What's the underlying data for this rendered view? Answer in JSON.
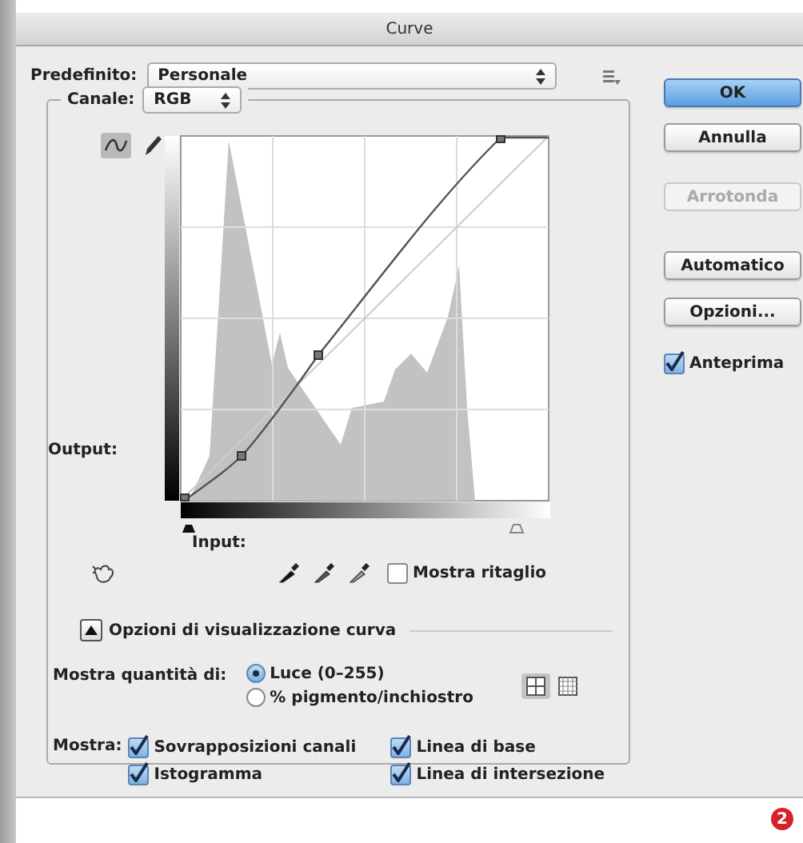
{
  "window": {
    "title": "Curve"
  },
  "preset": {
    "label": "Predefinito:",
    "value": "Personale"
  },
  "channel": {
    "label": "Canale:",
    "value": "RGB"
  },
  "tools": [
    {
      "kind": "curve",
      "selected": true
    },
    {
      "kind": "pencil",
      "selected": false
    }
  ],
  "graph": {
    "output_label": "Output:",
    "input_label": "Input:"
  },
  "show_clipping": {
    "label": "Mostra ritaglio",
    "checked": false
  },
  "display_options": {
    "label": "Opzioni di visualizzazione curva",
    "expanded": true
  },
  "show_amount": {
    "label": "Mostra quantità di:",
    "options": [
      {
        "label": "Luce (0–255)",
        "selected": true
      },
      {
        "label": "% pigmento/inchiostro",
        "selected": false
      }
    ]
  },
  "grid_buttons": [
    {
      "kind": "simple",
      "selected": true
    },
    {
      "kind": "detailed",
      "selected": false
    }
  ],
  "show": {
    "label": "Mostra:",
    "options": [
      {
        "label": "Sovrapposizioni canali",
        "checked": true
      },
      {
        "label": "Linea di base",
        "checked": true
      },
      {
        "label": "Istogramma",
        "checked": true
      },
      {
        "label": "Linea di intersezione",
        "checked": true
      }
    ]
  },
  "buttons": [
    {
      "label": "OK",
      "kind": "default",
      "disabled": false
    },
    {
      "label": "Annulla",
      "kind": "normal",
      "disabled": false
    },
    {
      "label": "Arrotonda",
      "kind": "normal",
      "disabled": true
    },
    {
      "label": "Automatico",
      "kind": "normal",
      "disabled": false
    },
    {
      "label": "Opzioni...",
      "kind": "normal",
      "disabled": false
    }
  ],
  "preview": {
    "label": "Anteprima",
    "checked": true
  },
  "callout": "2"
}
